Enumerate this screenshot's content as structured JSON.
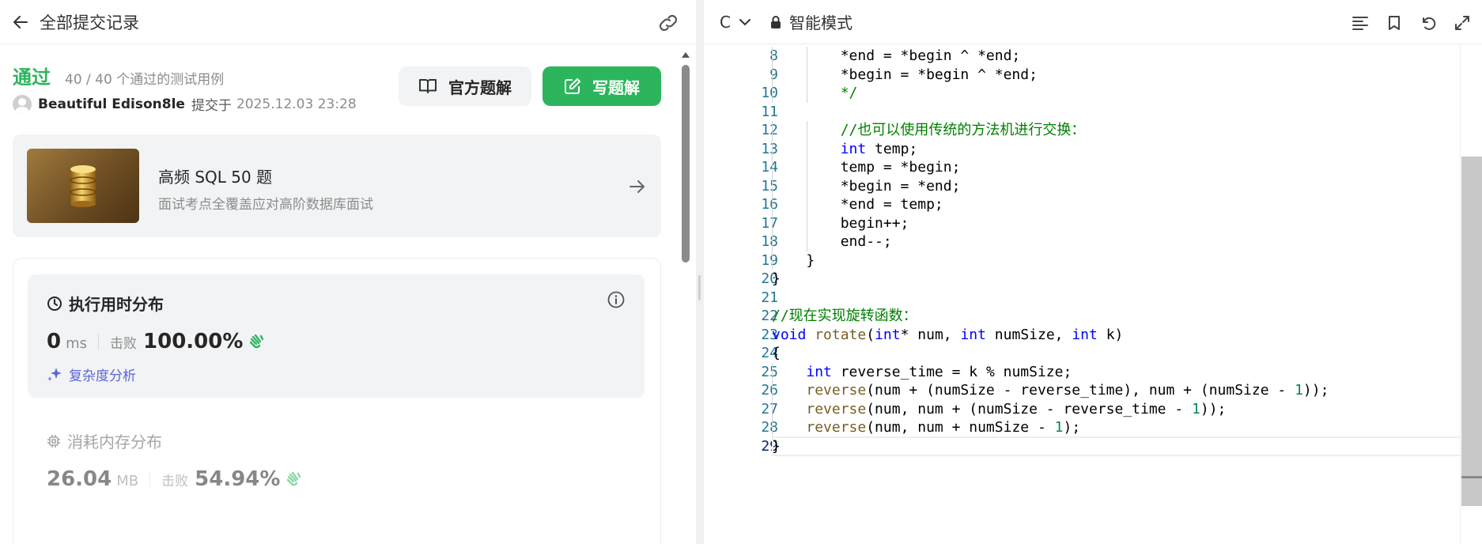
{
  "header": {
    "back_label": "全部提交记录"
  },
  "submission": {
    "status": "通过",
    "passed_cases": "40 / 40  个通过的测试用例",
    "username": "Beautiful Edison8le",
    "submitted_at_label": "提交于",
    "submitted_time": "2025.12.03 23:28"
  },
  "actions": {
    "official_solution": "官方题解",
    "write_solution": "写题解"
  },
  "promo": {
    "title": "高频 SQL 50 题",
    "subtitle": "面试考点全覆盖应对高阶数据库面试"
  },
  "runtime": {
    "title": "执行用时分布",
    "value": "0",
    "unit": "ms",
    "beat_label": "击败",
    "beat_percent": "100.00%",
    "analysis_link": "复杂度分析"
  },
  "memory": {
    "title": "消耗内存分布",
    "value": "26.04",
    "unit": "MB",
    "beat_label": "击败",
    "beat_percent": "54.94%"
  },
  "editor": {
    "language": "C",
    "mode": "智能模式",
    "lines": [
      {
        "n": "8",
        "text": "        *end = *begin ^ *end;"
      },
      {
        "n": "9",
        "text": "        *begin = *begin ^ *end;"
      },
      {
        "n": "10",
        "text": "        */"
      },
      {
        "n": "11",
        "text": ""
      },
      {
        "n": "12",
        "text": "        //也可以使用传统的方法机进行交换："
      },
      {
        "n": "13",
        "text": "        int temp;"
      },
      {
        "n": "14",
        "text": "        temp = *begin;"
      },
      {
        "n": "15",
        "text": "        *begin = *end;"
      },
      {
        "n": "16",
        "text": "        *end = temp;"
      },
      {
        "n": "17",
        "text": "        begin++;"
      },
      {
        "n": "18",
        "text": "        end--;"
      },
      {
        "n": "19",
        "text": "    }"
      },
      {
        "n": "20",
        "text": "}"
      },
      {
        "n": "21",
        "text": ""
      },
      {
        "n": "22",
        "text": "//现在实现旋转函数："
      },
      {
        "n": "23",
        "text": "void rotate(int* num, int numSize, int k)"
      },
      {
        "n": "24",
        "text": "{"
      },
      {
        "n": "25",
        "text": "    int reverse_time = k % numSize;"
      },
      {
        "n": "26",
        "text": "    reverse(num + (numSize - reverse_time), num + (numSize - 1));"
      },
      {
        "n": "27",
        "text": "    reverse(num, num + (numSize - reverse_time - 1));"
      },
      {
        "n": "28",
        "text": "    reverse(num, num + numSize - 1);"
      },
      {
        "n": "29",
        "text": "}"
      }
    ]
  },
  "colors": {
    "accent_green": "#2db55d",
    "link_purple": "#5a67d8",
    "keyword_blue": "#0000ff",
    "comment_green": "#008000",
    "function_brown": "#795e26",
    "number_green": "#098658",
    "line_number": "#237893"
  },
  "icons": [
    "arrow-left-icon",
    "link-icon",
    "book-icon",
    "edit-icon",
    "database-icon",
    "arrow-right-icon",
    "clock-icon",
    "info-icon",
    "clap-hand-icon",
    "sparkle-icon",
    "chip-icon",
    "chevron-down-icon",
    "lock-icon",
    "format-icon",
    "bookmark-icon",
    "undo-icon",
    "expand-icon"
  ]
}
